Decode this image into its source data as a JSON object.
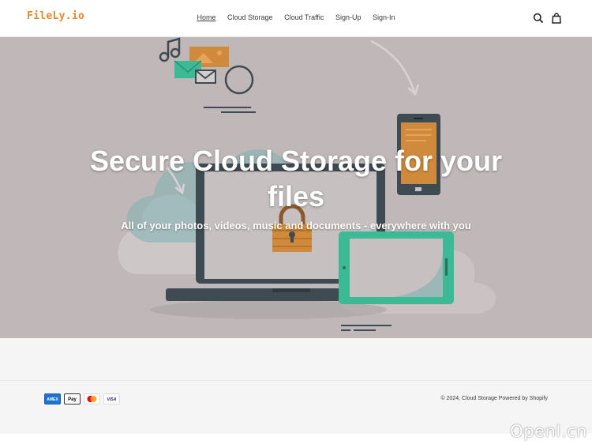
{
  "brand": {
    "logo_text": "FileLy.io",
    "accent": "#e8882b"
  },
  "nav": {
    "items": [
      {
        "label": "Home",
        "active": true
      },
      {
        "label": "Cloud Storage",
        "active": false
      },
      {
        "label": "Cloud Traffic",
        "active": false
      },
      {
        "label": "Sign-Up",
        "active": false
      },
      {
        "label": "Sign-In",
        "active": false
      }
    ]
  },
  "header_icons": {
    "search": "search-icon",
    "cart": "cart-icon"
  },
  "hero": {
    "title": "Secure Cloud Storage for your files",
    "subtitle": "All of your photos, videos, music and documents - everywhere with you",
    "background": "#c0b8b8"
  },
  "footer": {
    "payments": [
      {
        "name": "american-express-icon",
        "label": "AMEX"
      },
      {
        "name": "apple-pay-icon",
        "label": "Pay"
      },
      {
        "name": "mastercard-icon",
        "label": ""
      },
      {
        "name": "visa-icon",
        "label": "VISA"
      }
    ],
    "copyright_prefix": "© 2024,",
    "store_name": "Cloud Storage",
    "powered_by": "Powered by Shopify"
  },
  "watermark": "OpenI.cn"
}
